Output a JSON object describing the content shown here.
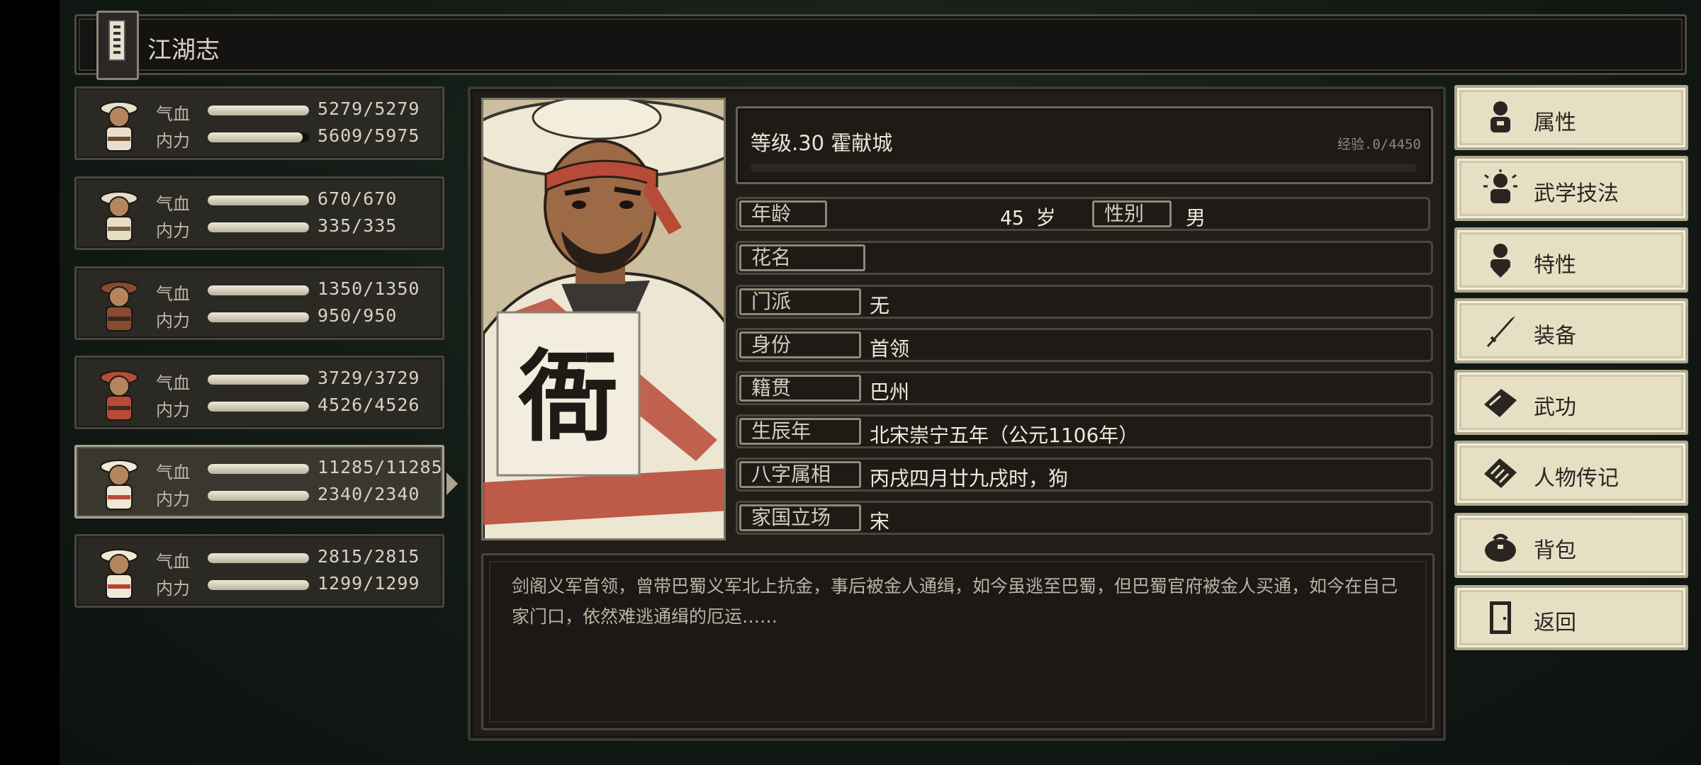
{
  "header": {
    "title": "江湖志"
  },
  "party": [
    {
      "hp_label": "气血",
      "mp_label": "内力",
      "hp": "5279/5279",
      "mp": "5609/5975",
      "hp_fill": 1.0,
      "mp_fill": 0.939,
      "selected": false
    },
    {
      "hp_label": "气血",
      "mp_label": "内力",
      "hp": "670/670",
      "mp": "335/335",
      "hp_fill": 1.0,
      "mp_fill": 1.0,
      "selected": false
    },
    {
      "hp_label": "气血",
      "mp_label": "内力",
      "hp": "1350/1350",
      "mp": "950/950",
      "hp_fill": 1.0,
      "mp_fill": 1.0,
      "selected": false
    },
    {
      "hp_label": "气血",
      "mp_label": "内力",
      "hp": "3729/3729",
      "mp": "4526/4526",
      "hp_fill": 1.0,
      "mp_fill": 1.0,
      "selected": false
    },
    {
      "hp_label": "气血",
      "mp_label": "内力",
      "hp": "11285/11285",
      "mp": "2340/2340",
      "hp_fill": 1.0,
      "mp_fill": 1.0,
      "selected": true
    },
    {
      "hp_label": "气血",
      "mp_label": "内力",
      "hp": "2815/2815",
      "mp": "1299/1299",
      "hp_fill": 1.0,
      "mp_fill": 1.0,
      "selected": false
    }
  ],
  "character": {
    "level_line": "等级.30 霍献城",
    "exp": "经验.0/4450",
    "exp_fill": 0.0,
    "age_label": "年龄",
    "age_value": "45 岁",
    "gender_label": "性别",
    "gender_value": "男",
    "nickname_label": "花名",
    "nickname_value": "",
    "sect_label": "门派",
    "sect_value": "无",
    "identity_label": "身份",
    "identity_value": "首领",
    "origin_label": "籍贯",
    "origin_value": "巴州",
    "birth_label": "生辰年",
    "birth_value": "北宋崇宁五年（公元1106年）",
    "bazi_label": "八字属相",
    "bazi_value": "丙戌四月廿九戌时，狗",
    "allegiance_label": "家国立场",
    "allegiance_value": "宋",
    "portrait_sign": "衙",
    "description": "剑阁义军首领，曾带巴蜀义军北上抗金，事后被金人通缉，如今虽逃至巴蜀，但巴蜀官府被金人买通，如今在自己家门口，依然难逃通缉的厄运……"
  },
  "menu": {
    "attributes": "属性",
    "martial_skills": "武学技法",
    "traits": "特性",
    "equipment": "装备",
    "kungfu": "武功",
    "biography": "人物传记",
    "backpack": "背包",
    "back": "返回"
  },
  "colors": {
    "accent_cream": "#e6dfc4",
    "panel_dark": "#211e1a",
    "bar_fill": "#e0d9c4"
  }
}
